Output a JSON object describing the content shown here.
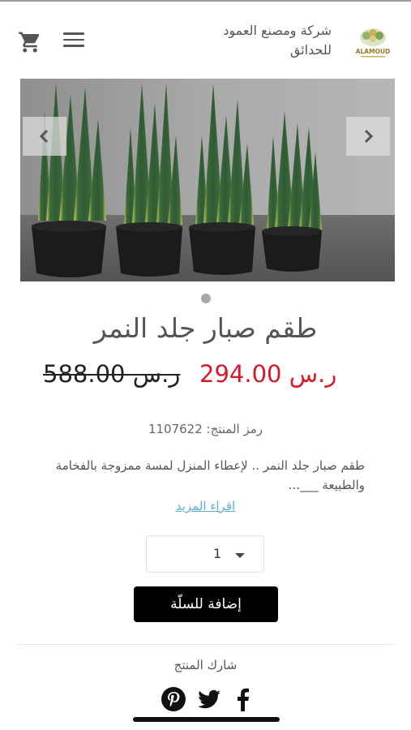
{
  "header": {
    "brand_line1": "شركة ومصنع العمود",
    "brand_line2": "للحدائق",
    "logo_text": "ALAMOUD",
    "cart_icon": "cart-icon",
    "menu_icon": "hamburger-menu-icon"
  },
  "gallery": {
    "prev_icon": "chevron-left-icon",
    "next_icon": "chevron-right-icon",
    "slide_count": 1,
    "active_slide": 1
  },
  "product": {
    "title": "طقم صبار جلد النمر",
    "old_price": "588.00 ر.س",
    "new_price": "294.00 ر.س",
    "sku_label": "رمز المنتج: 1107622",
    "description": "طقم صبار جلد النمر .. لإعطاء المنزل لمسة ممزوجة بالفخامة والطبيعة  ___...",
    "read_more": "اقراء المزيد",
    "quantity": "1",
    "add_to_cart": "إضافة للسلّة"
  },
  "share": {
    "label": "شارك المنتج",
    "icons": [
      "pinterest-icon",
      "twitter-icon",
      "facebook-icon"
    ]
  },
  "colors": {
    "sale_price": "#d71a2a",
    "link": "#5aaed4",
    "button_bg": "#000000"
  }
}
